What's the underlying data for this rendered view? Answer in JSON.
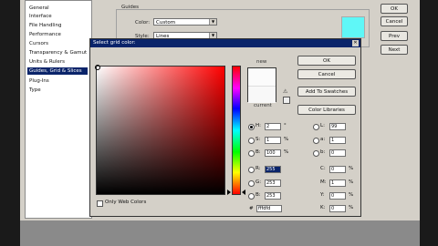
{
  "prefs": {
    "categories": [
      "General",
      "Interface",
      "File Handling",
      "Performance",
      "Cursors",
      "Transparency & Gamut",
      "Units & Rulers",
      "Guides, Grid & Slices",
      "Plug-Ins",
      "Type"
    ],
    "selected_index": 7,
    "guides_title": "Guides",
    "color_label": "Color:",
    "color_value": "Custom",
    "style_label": "Style:",
    "style_value": "Lines",
    "buttons": {
      "ok": "OK",
      "cancel": "Cancel",
      "prev": "Prev",
      "next": "Next"
    },
    "guide_color": "#5ff7f7"
  },
  "picker": {
    "title": "Select grid color:",
    "new_label": "new",
    "current_label": "current",
    "new_color": "#fbfbfb",
    "current_color": "#f8f8f8",
    "only_web_colors": "Only Web Colors",
    "buttons": {
      "ok": "OK",
      "cancel": "Cancel",
      "add_to_swatches": "Add To Swatches",
      "color_libraries": "Color Libraries"
    },
    "hsb": [
      {
        "label": "H:",
        "value": "2",
        "unit": "°",
        "selected": true
      },
      {
        "label": "S:",
        "value": "1",
        "unit": "%",
        "selected": false
      },
      {
        "label": "B:",
        "value": "100",
        "unit": "%",
        "selected": false
      }
    ],
    "rgb": [
      {
        "label": "R:",
        "value": "255",
        "highlighted": true
      },
      {
        "label": "G:",
        "value": "253"
      },
      {
        "label": "B:",
        "value": "253"
      }
    ],
    "lab": [
      {
        "label": "L:",
        "value": "99"
      },
      {
        "label": "a:",
        "value": "1"
      },
      {
        "label": "b:",
        "value": "0"
      }
    ],
    "cmyk": [
      {
        "label": "C:",
        "value": "0",
        "unit": "%"
      },
      {
        "label": "M:",
        "value": "1",
        "unit": "%"
      },
      {
        "label": "Y:",
        "value": "0",
        "unit": "%"
      },
      {
        "label": "K:",
        "value": "0",
        "unit": "%"
      }
    ],
    "hex_label": "#",
    "hex_value": "fffdfd"
  }
}
